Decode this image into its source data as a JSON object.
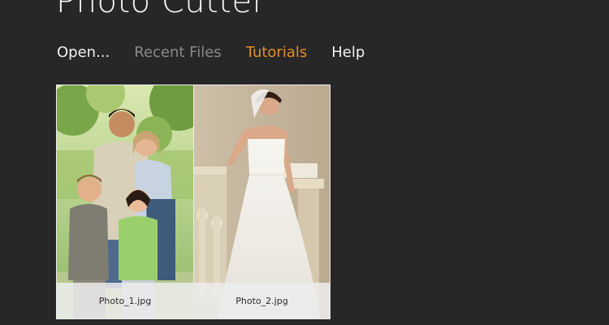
{
  "app": {
    "title": "Photo Cutter"
  },
  "nav": {
    "items": [
      {
        "label": "Open...",
        "state": "normal"
      },
      {
        "label": "Recent Files",
        "state": "dim"
      },
      {
        "label": "Tutorials",
        "state": "accent"
      },
      {
        "label": "Help",
        "state": "normal"
      }
    ]
  },
  "gallery": {
    "photos": [
      {
        "filename": "Photo_1.jpg",
        "subject": "family-portrait-outdoors"
      },
      {
        "filename": "Photo_2.jpg",
        "subject": "bride-in-white-dress"
      }
    ]
  },
  "colors": {
    "background": "#272727",
    "accent": "#e0902e",
    "text": "#f1f1f1",
    "dim_text": "#8a8a8a"
  }
}
